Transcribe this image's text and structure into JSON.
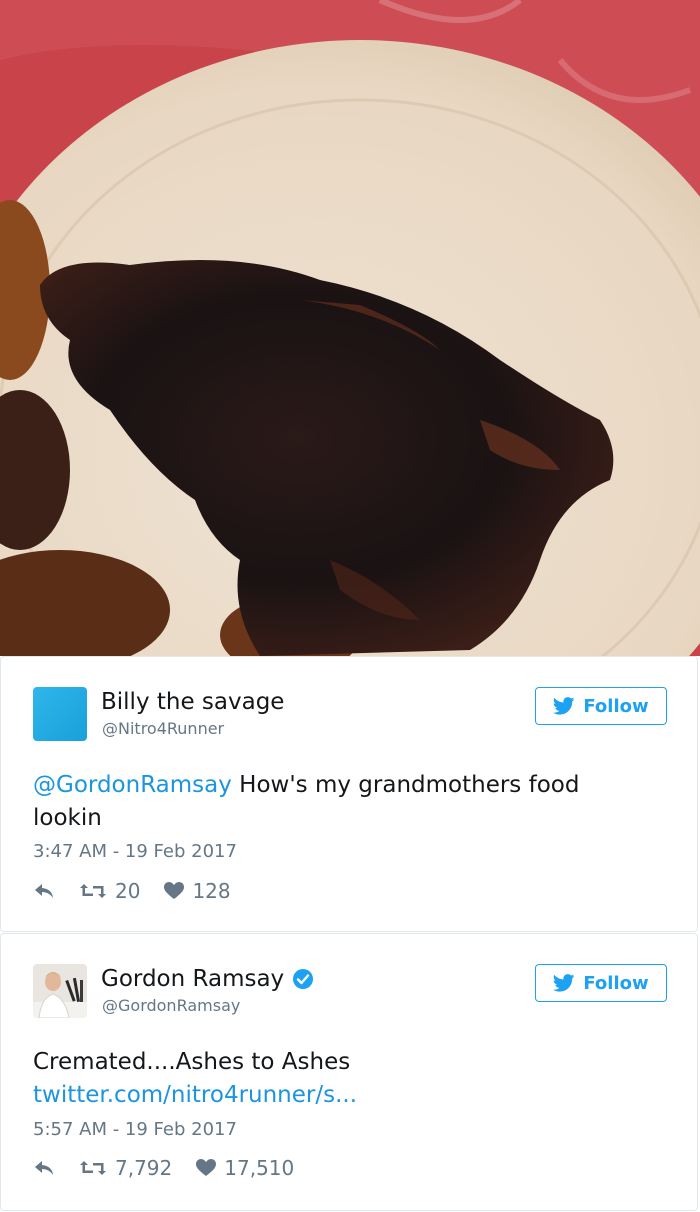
{
  "tweets": [
    {
      "display_name": "Billy the savage",
      "handle": "@Nitro4Runner",
      "follow_label": "Follow",
      "mention": "@GordonRamsay",
      "text": " How's my grandmothers food lookin",
      "timestamp": "3:47 AM - 19 Feb 2017",
      "retweets": "20",
      "likes": "128",
      "avatar_color": "#1da1f2"
    },
    {
      "display_name": "Gordon Ramsay",
      "handle": "@GordonRamsay",
      "follow_label": "Follow",
      "text": "Cremated....Ashes to Ashes",
      "link": "twitter.com/nitro4runner/s...",
      "timestamp": "5:57 AM - 19 Feb 2017",
      "retweets": "7,792",
      "likes": "17,510",
      "verified": true
    }
  ],
  "colors": {
    "twitter_blue": "#1da1f2",
    "link_blue": "#1b95e0",
    "muted_gray": "#657786",
    "border": "#e1e8ed"
  },
  "icons": [
    "reply-icon",
    "retweet-icon",
    "heart-icon",
    "twitter-bird-icon",
    "verified-badge-icon"
  ]
}
